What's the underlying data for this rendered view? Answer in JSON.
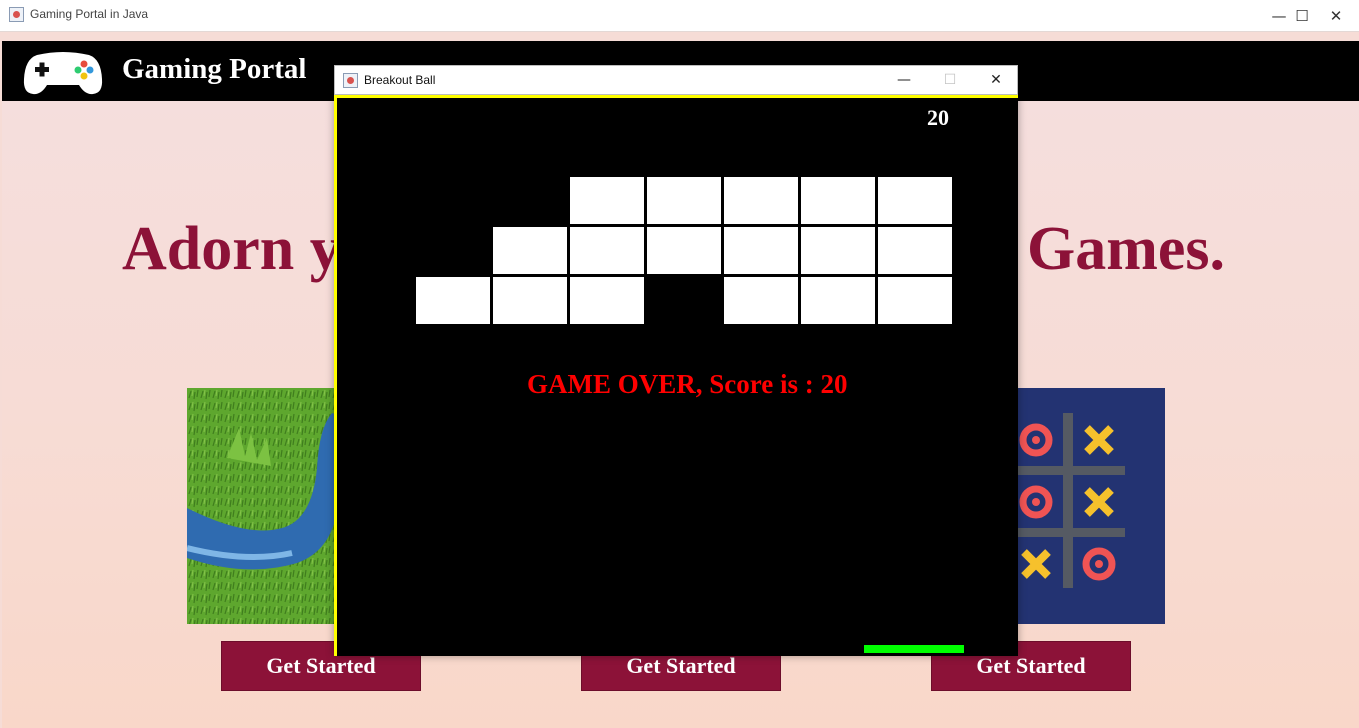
{
  "window": {
    "title": "Gaming Portal in Java",
    "controls": {
      "minimize": "—",
      "maximize": "☐",
      "close": "✕"
    }
  },
  "header": {
    "logo_icon": "gamepad-icon",
    "title": "Gaming Portal"
  },
  "main": {
    "headline_left": "Adorn y",
    "headline_right": "Games.",
    "cards": [
      {
        "icon": "snake-game-image",
        "button_label": "Get Started"
      },
      {
        "icon": "breakout-game-image",
        "button_label": "Get Started"
      },
      {
        "icon": "tic-tac-toe-image",
        "button_label": "Get Started"
      }
    ]
  },
  "breakout": {
    "title": "Breakout Ball",
    "controls": {
      "minimize": "—",
      "maximize": "☐",
      "close": "✕"
    },
    "score": "20",
    "message": "GAME OVER, Score is : 20",
    "bricks": [
      [
        0,
        0,
        1,
        1,
        1,
        1,
        1
      ],
      [
        0,
        1,
        1,
        1,
        1,
        1,
        1
      ],
      [
        1,
        1,
        1,
        0,
        1,
        1,
        1
      ]
    ],
    "colors": {
      "border": "#ffff00",
      "paddle": "#00ff00",
      "message": "#ff0000",
      "brick": "#ffffff",
      "background": "#000000"
    }
  },
  "colors": {
    "accent": "#8c1238",
    "header_bg": "#000000",
    "page_bg": "#f6dcd6"
  }
}
